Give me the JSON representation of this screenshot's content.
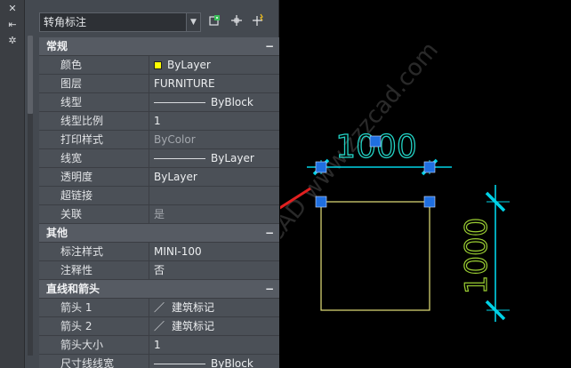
{
  "left_strip": {
    "icons": [
      "close-icon",
      "pin-icon",
      "settings-icon"
    ]
  },
  "toolbar": {
    "object_type": "转角标注",
    "buttons": [
      "quick-select-icon",
      "select-objects-icon",
      "pickadd-toggle-icon"
    ]
  },
  "sections": [
    {
      "title": "常规",
      "collapse_glyph": "−",
      "rows": [
        {
          "label": "颜色",
          "value": "ByLayer",
          "kind": "color",
          "swatch_color": "#ffff00"
        },
        {
          "label": "图层",
          "value": "FURNITURE"
        },
        {
          "label": "线型",
          "value": "ByBlock",
          "kind": "line"
        },
        {
          "label": "线型比例",
          "value": "1"
        },
        {
          "label": "打印样式",
          "value": "ByColor",
          "dim": true
        },
        {
          "label": "线宽",
          "value": "ByLayer",
          "kind": "line"
        },
        {
          "label": "透明度",
          "value": "ByLayer"
        },
        {
          "label": "超链接",
          "value": ""
        },
        {
          "label": "关联",
          "value": "是",
          "dim": true
        }
      ]
    },
    {
      "title": "其他",
      "collapse_glyph": "−",
      "rows": [
        {
          "label": "标注样式",
          "value": "MINI-100"
        },
        {
          "label": "注释性",
          "value": "否"
        }
      ]
    },
    {
      "title": "直线和箭头",
      "collapse_glyph": "−",
      "rows": [
        {
          "label": "箭头 1",
          "value": "建筑标记",
          "kind": "arrow"
        },
        {
          "label": "箭头 2",
          "value": "建筑标记",
          "kind": "arrow"
        },
        {
          "label": "箭头大小",
          "value": "1"
        },
        {
          "label": "尺寸线线宽",
          "value": "ByBlock",
          "kind": "line"
        }
      ]
    }
  ],
  "drawing": {
    "horizontal_dim_text": "1000",
    "vertical_dim_text": "1000",
    "watermark": "周站长CAD  www.zzzcad.com",
    "colors": {
      "dimension": "#00d2e6",
      "dim_text_h": "#22d3c5",
      "dim_text_v": "#9acd32",
      "rectangle": "#e6e27a",
      "grip": "#1f6fe0",
      "annotation_arrow": "#e02020"
    }
  }
}
